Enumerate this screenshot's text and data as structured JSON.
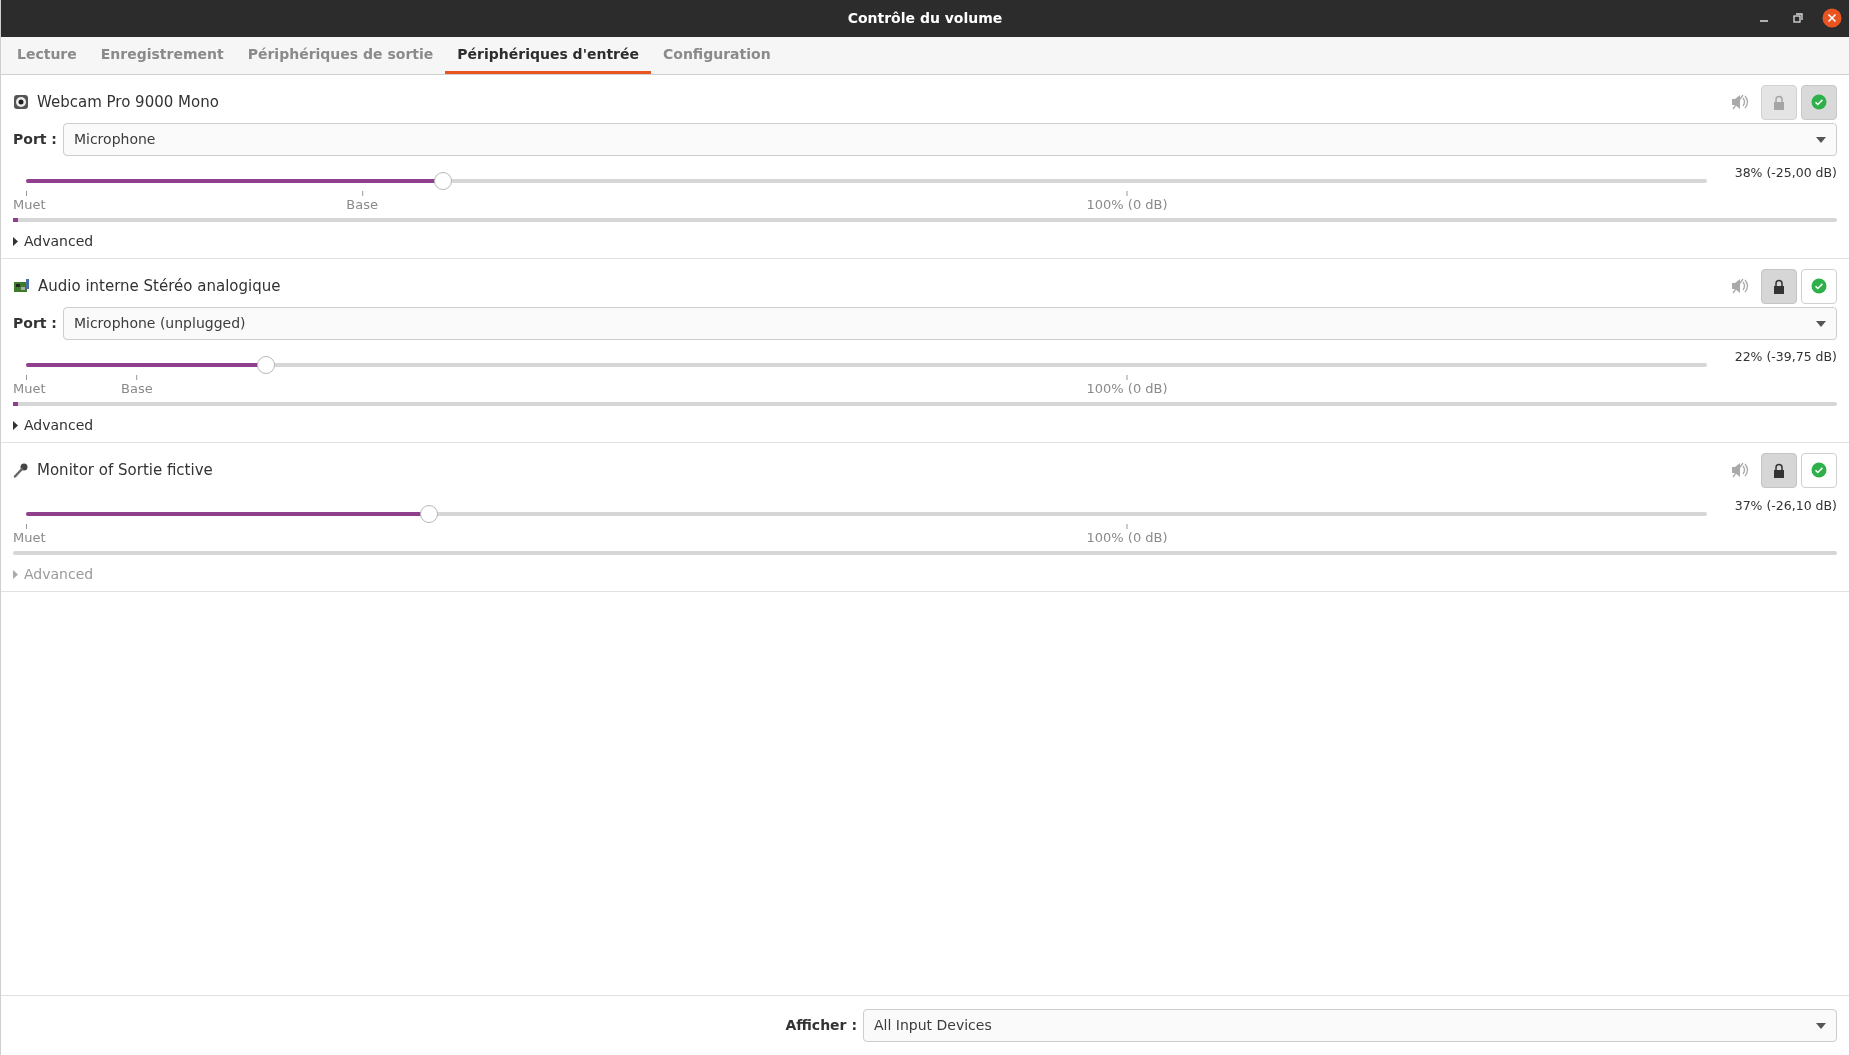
{
  "window": {
    "title": "Contrôle du volume"
  },
  "tabs": [
    {
      "label": "Lecture",
      "selected": false
    },
    {
      "label": "Enregistrement",
      "selected": false
    },
    {
      "label": "Périphériques de sortie",
      "selected": false
    },
    {
      "label": "Périphériques d'entrée",
      "selected": true
    },
    {
      "label": "Configuration",
      "selected": false
    }
  ],
  "devices": [
    {
      "kind": "webcam",
      "name": "Webcam Pro 9000 Mono",
      "muted": false,
      "locked": false,
      "default": true,
      "port": {
        "label": "Port :",
        "value": "Microphone"
      },
      "volume": {
        "level": 0.248,
        "reading": "38% (-25,00 dB)",
        "marks": [
          {
            "kind": "mute",
            "label": "Muet"
          },
          {
            "kind": "base",
            "label": "Base"
          },
          {
            "kind": "norm",
            "label": "100% (0 dB)"
          }
        ]
      },
      "meter": {
        "level": 0.003
      },
      "advanced": {
        "label": "Advanced",
        "disabled": false
      }
    },
    {
      "kind": "soundcard",
      "name": "Audio interne Stéréo analogique",
      "muted": false,
      "locked": true,
      "default": false,
      "port": {
        "label": "Port :",
        "value": "Microphone (unplugged)"
      },
      "volume": {
        "level": 0.143,
        "reading": "22% (-39,75 dB)",
        "marks": [
          {
            "kind": "mute",
            "label": "Muet"
          },
          {
            "kind": "base",
            "label": "Base"
          },
          {
            "kind": "norm",
            "label": "100% (0 dB)"
          }
        ]
      },
      "meter": {
        "level": 0.003
      },
      "advanced": {
        "label": "Advanced",
        "disabled": false
      }
    },
    {
      "kind": "microphone",
      "name": "Monitor of Sortie fictive",
      "muted": false,
      "locked": true,
      "default": false,
      "volume": {
        "level": 0.24,
        "reading": "37% (-26,10 dB)",
        "marks": [
          {
            "kind": "mute",
            "label": "Muet"
          },
          {
            "kind": "norm",
            "label": "100% (0 dB)"
          }
        ]
      },
      "advanced": {
        "label": "Advanced",
        "disabled": true
      }
    }
  ],
  "footer": {
    "label": "Afficher :",
    "value": "All Input Devices"
  }
}
